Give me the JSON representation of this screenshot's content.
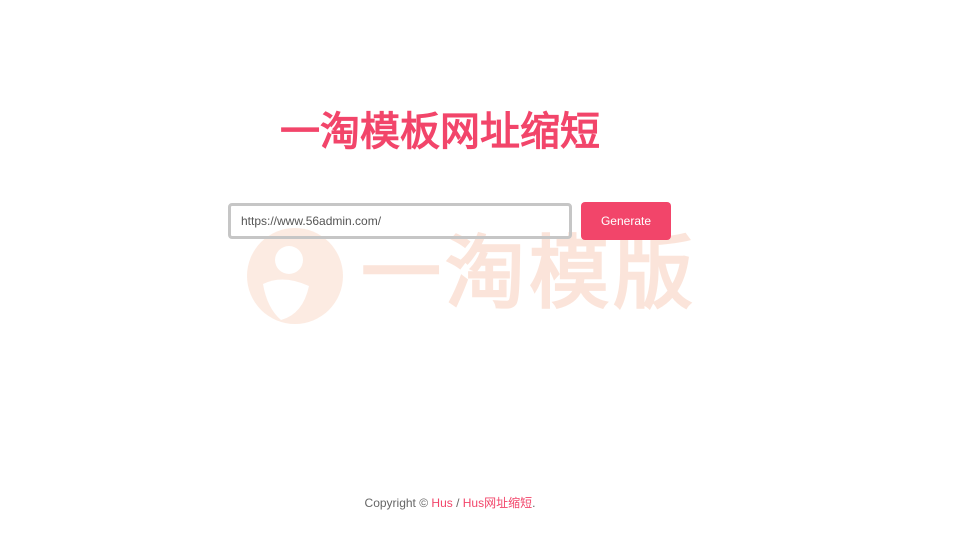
{
  "header": {
    "title": "一淘模板网址缩短"
  },
  "watermark": {
    "text": "一淘模版",
    "color": "#f08a5a"
  },
  "form": {
    "url_value": "https://www.56admin.com/",
    "generate_label": "Generate"
  },
  "footer": {
    "prefix": "Copyright © ",
    "link_hus": "Hus",
    "separator": " / ",
    "link_site": "Hus网址缩短",
    "suffix": "."
  },
  "colors": {
    "accent": "#f2456a",
    "input_border": "#c6c6c6"
  }
}
